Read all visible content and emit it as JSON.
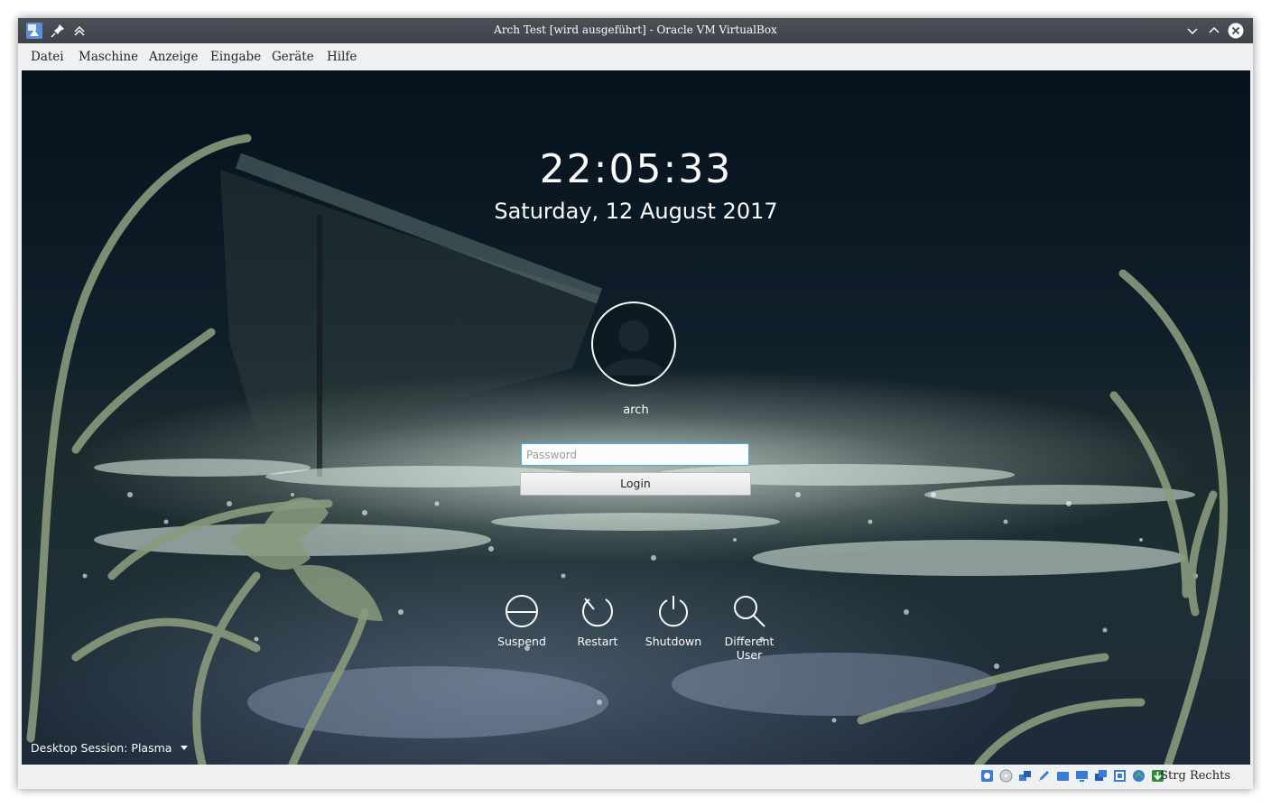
{
  "window": {
    "title": "Arch Test [wird ausgeführt] - Oracle VM VirtualBox"
  },
  "menubar": {
    "items": [
      "Datei",
      "Maschine",
      "Anzeige",
      "Eingabe",
      "Geräte",
      "Hilfe"
    ]
  },
  "login_screen": {
    "clock": "22:05:33",
    "date": "Saturday, 12 August 2017",
    "username": "arch",
    "password_placeholder": "Password",
    "password_value": "",
    "login_label": "Login",
    "actions": [
      {
        "label": "Suspend",
        "icon": "suspend-icon"
      },
      {
        "label": "Restart",
        "icon": "restart-icon"
      },
      {
        "label": "Shutdown",
        "icon": "shutdown-icon"
      },
      {
        "label": "Different User",
        "icon": "search-user-icon"
      }
    ],
    "session_label": "Desktop Session: Plasma"
  },
  "statusbar": {
    "host_key": "Strg Rechts",
    "icons": [
      "hard-disk-icon",
      "optical-drive-icon",
      "network-icon",
      "pen-icon",
      "shared-folders-icon",
      "display-icon",
      "video-capture-icon",
      "cpu-icon",
      "usb-icon",
      "mouse-integration-icon"
    ]
  },
  "colors": {
    "titlebar": "#4b5158",
    "accent": "#3daee9",
    "window_bg": "#eff0f1",
    "vine": "#8a9a7d"
  }
}
